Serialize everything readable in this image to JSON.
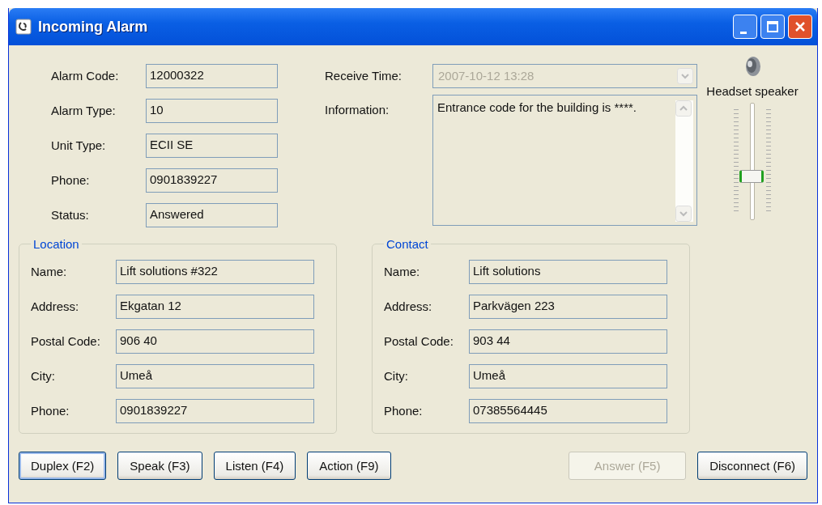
{
  "window": {
    "title": "Incoming Alarm"
  },
  "alarm_fields": [
    {
      "label": "Alarm Code:",
      "value": "12000322"
    },
    {
      "label": "Alarm Type:",
      "value": "10"
    },
    {
      "label": "Unit Type:",
      "value": "ECII SE"
    },
    {
      "label": "Phone:",
      "value": "0901839227"
    },
    {
      "label": "Status:",
      "value": "Answered"
    }
  ],
  "receive_time": {
    "label": "Receive Time:",
    "value": "2007-10-12 13:28",
    "disabled": true
  },
  "information": {
    "label": "Information:",
    "value": "Entrance code for the building is ****."
  },
  "volume": {
    "label": "Headset speaker",
    "level": 0.37
  },
  "groups": [
    {
      "title": "Location",
      "fields": [
        {
          "label": "Name:",
          "value": "Lift solutions #322"
        },
        {
          "label": "Address:",
          "value": "Ekgatan 12"
        },
        {
          "label": "Postal Code:",
          "value": "906 40"
        },
        {
          "label": "City:",
          "value": "Umeå"
        },
        {
          "label": "Phone:",
          "value": "0901839227"
        }
      ]
    },
    {
      "title": "Contact",
      "fields": [
        {
          "label": "Name:",
          "value": "Lift solutions"
        },
        {
          "label": "Address:",
          "value": "Parkvägen 223"
        },
        {
          "label": "Postal Code:",
          "value": "903 44"
        },
        {
          "label": "City:",
          "value": "Umeå"
        },
        {
          "label": "Phone:",
          "value": "07385564445"
        }
      ]
    }
  ],
  "buttons": [
    {
      "label": "Duplex (F2)",
      "disabled": false,
      "focused": true
    },
    {
      "label": "Speak (F3)",
      "disabled": false,
      "focused": false
    },
    {
      "label": "Listen (F4)",
      "disabled": false,
      "focused": false
    },
    {
      "label": "Action (F9)",
      "disabled": false,
      "focused": false
    },
    {
      "label": "Answer (F5)",
      "disabled": true,
      "focused": false
    },
    {
      "label": "Disconnect (F6)",
      "disabled": false,
      "focused": false
    }
  ]
}
